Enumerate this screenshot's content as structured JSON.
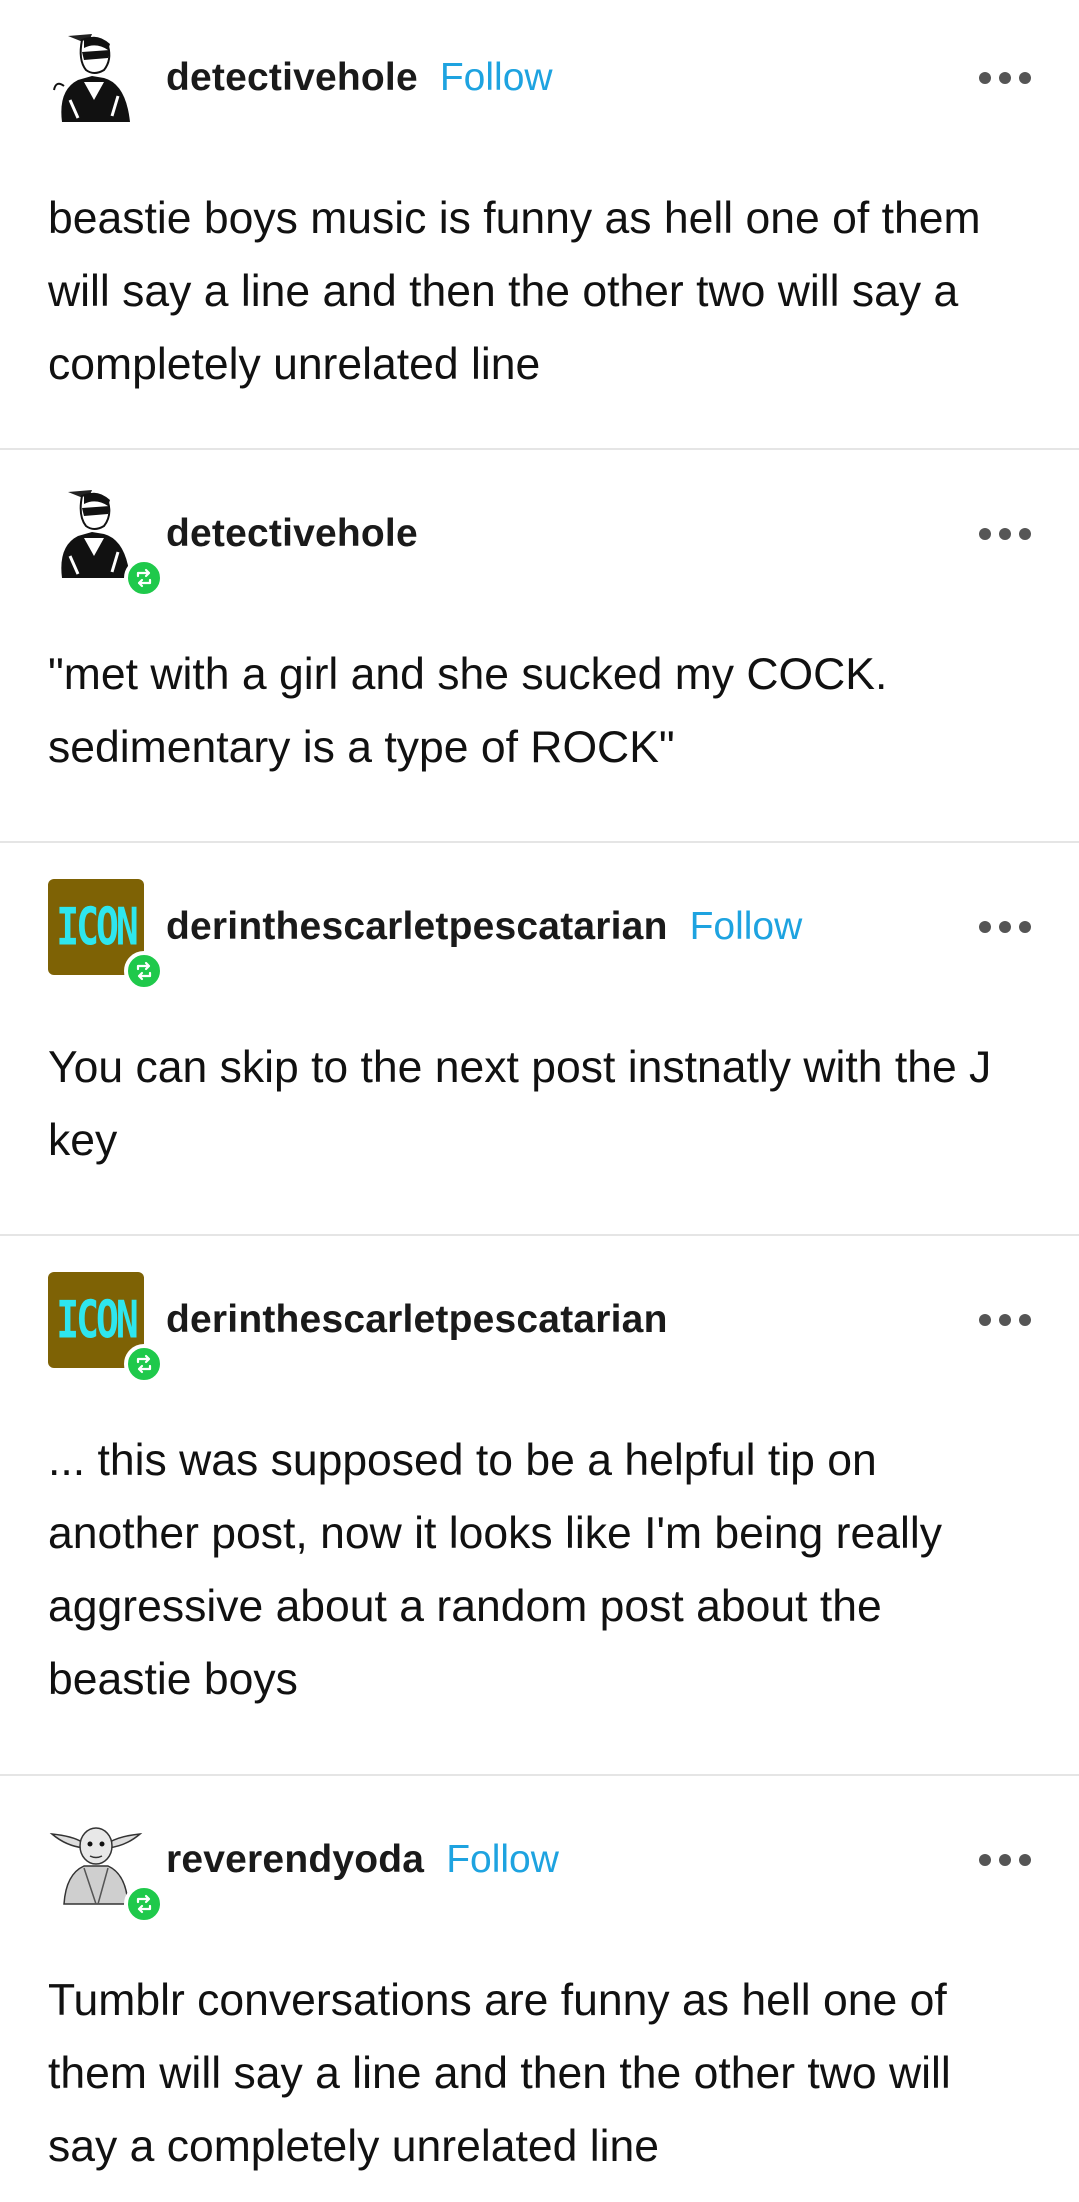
{
  "posts": [
    {
      "username": "detectivehole",
      "follow_label": "Follow",
      "avatar_icon": "sunglasses-man-sketch",
      "reblogged": false,
      "text": "beastie boys music is funny as hell one of them will say a line and then the other two will say a completely unrelated line"
    },
    {
      "username": "detectivehole",
      "follow_label": "",
      "avatar_icon": "sunglasses-man-sketch",
      "reblogged": true,
      "text": "\"met with a girl and she sucked my COCK. sedimentary is a type of ROCK\""
    },
    {
      "username": "derinthescarletpescatarian",
      "follow_label": "Follow",
      "avatar_text": "ICON",
      "reblogged": true,
      "text": "You can skip to the next post instnatly with the J key"
    },
    {
      "username": "derinthescarletpescatarian",
      "follow_label": "",
      "avatar_text": "ICON",
      "reblogged": true,
      "text": "... this was supposed to be a helpful tip on another post, now it looks like I'm being really aggressive about a random post about the beastie boys"
    },
    {
      "username": "reverendyoda",
      "follow_label": "Follow",
      "avatar_icon": "yoda-sketch",
      "reblogged": true,
      "text": "Tumblr conversations are funny as hell one of them will say a line and then the other two will say a completely unrelated line"
    }
  ],
  "colors": {
    "follow": "#1ea3e0",
    "reblog_badge": "#1fc94b",
    "icon_bg": "#7e6205",
    "icon_text": "#2ee6ee",
    "divider": "#e5e5e5"
  }
}
